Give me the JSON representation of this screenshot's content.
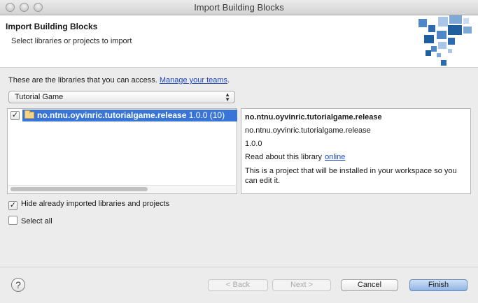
{
  "window": {
    "title": "Import Building Blocks"
  },
  "banner": {
    "title": "Import Building Blocks",
    "subtitle": "Select libraries or projects to import"
  },
  "access": {
    "text": "These are the libraries that you can access.",
    "link": "Manage your teams",
    "suffix": "."
  },
  "filter": {
    "selected": "Tutorial Game"
  },
  "tree": {
    "items": [
      {
        "name": "no.ntnu.oyvinric.tutorialgame.release",
        "version": "1.0.0 (10)",
        "checked": true,
        "selected": true
      }
    ]
  },
  "detail": {
    "title": "no.ntnu.oyvinric.tutorialgame.release",
    "name": "no.ntnu.oyvinric.tutorialgame.release",
    "version": "1.0.0",
    "read_about": "Read about this library",
    "online_link": "online",
    "description": "This is a project that will be installed in your workspace so you can edit it."
  },
  "options": {
    "hide_imported": {
      "label": "Hide already imported libraries and projects",
      "checked": true
    },
    "select_all": {
      "label": "Select all",
      "checked": false
    }
  },
  "buttons": {
    "back": "< Back",
    "next": "Next >",
    "cancel": "Cancel",
    "finish": "Finish"
  },
  "icons": {
    "help": "help-icon",
    "folder": "folder-icon",
    "check": "checkmark-icon"
  },
  "colors": {
    "selection": "#3875d7",
    "link": "#1f45c0",
    "decor_dark": "#1f5f9e",
    "decor_light": "#7ea9d6"
  }
}
